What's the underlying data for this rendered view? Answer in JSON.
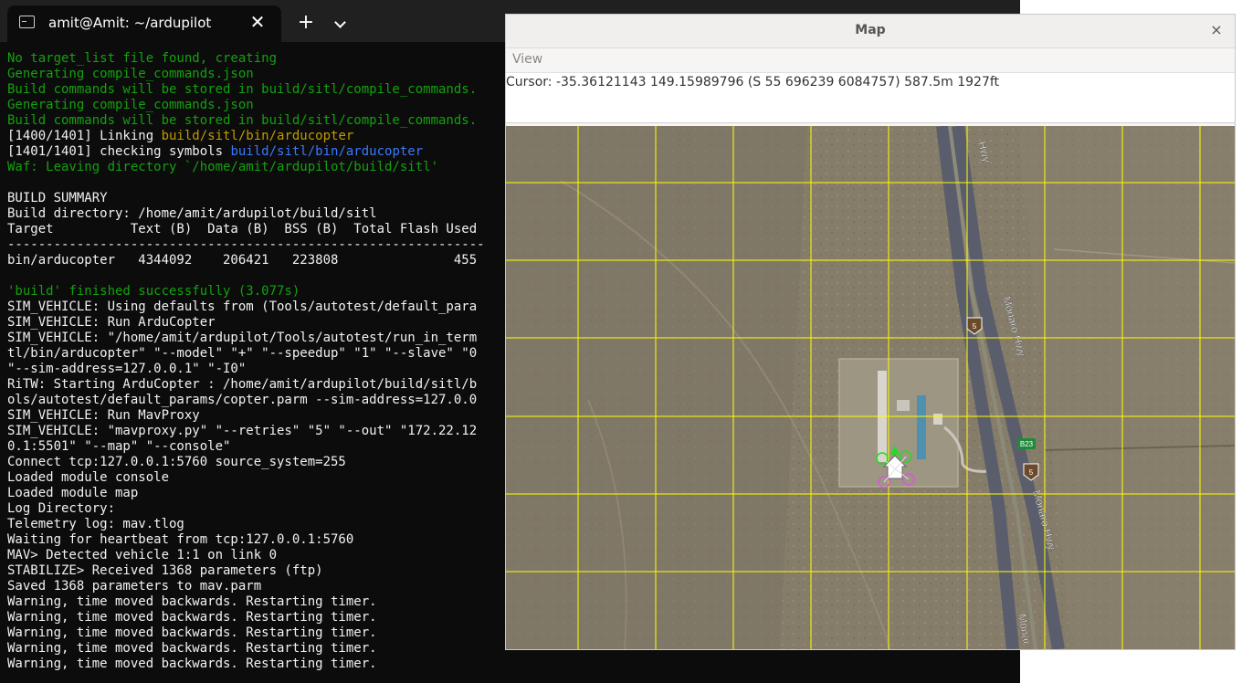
{
  "terminal": {
    "tab_title": "amit@Amit: ~/ardupilot",
    "tab_close": "✕",
    "new_tab": "+",
    "lines": [
      {
        "segs": [
          {
            "t": "No target_list file found, creating",
            "c": "green"
          }
        ]
      },
      {
        "segs": [
          {
            "t": "Generating compile_commands.json",
            "c": "green"
          }
        ]
      },
      {
        "segs": [
          {
            "t": "Build commands will be stored in build/sitl/compile_commands.",
            "c": "green"
          }
        ]
      },
      {
        "segs": [
          {
            "t": "Generating compile_commands.json",
            "c": "green"
          }
        ]
      },
      {
        "segs": [
          {
            "t": "Build commands will be stored in build/sitl/compile_commands.",
            "c": "green"
          }
        ]
      },
      {
        "segs": [
          {
            "t": "[1400/1401] Linking ",
            "c": "white"
          },
          {
            "t": "build/sitl/bin/arducopter",
            "c": "yellow"
          }
        ]
      },
      {
        "segs": [
          {
            "t": "[1401/1401] checking symbols ",
            "c": "white"
          },
          {
            "t": "build/sitl/bin/arducopter",
            "c": "blue"
          }
        ]
      },
      {
        "segs": [
          {
            "t": "Waf: Leaving directory `/home/amit/ardupilot/build/sitl'",
            "c": "green"
          }
        ]
      },
      {
        "segs": [
          {
            "t": "",
            "c": "white"
          }
        ]
      },
      {
        "segs": [
          {
            "t": "BUILD SUMMARY",
            "c": "white"
          }
        ]
      },
      {
        "segs": [
          {
            "t": "Build directory: /home/amit/ardupilot/build/sitl",
            "c": "white"
          }
        ]
      },
      {
        "segs": [
          {
            "t": "Target          Text (B)  Data (B)  BSS (B)  Total Flash Used",
            "c": "white"
          }
        ]
      },
      {
        "segs": [
          {
            "t": "--------------------------------------------------------------",
            "c": "white"
          }
        ]
      },
      {
        "segs": [
          {
            "t": "bin/arducopter   4344092    206421   223808               455",
            "c": "white"
          }
        ]
      },
      {
        "segs": [
          {
            "t": "",
            "c": "white"
          }
        ]
      },
      {
        "segs": [
          {
            "t": "'build' finished successfully (3.077s)",
            "c": "green"
          }
        ]
      },
      {
        "segs": [
          {
            "t": "SIM_VEHICLE: Using defaults from (Tools/autotest/default_para",
            "c": "white"
          }
        ]
      },
      {
        "segs": [
          {
            "t": "SIM_VEHICLE: Run ArduCopter",
            "c": "white"
          }
        ]
      },
      {
        "segs": [
          {
            "t": "SIM_VEHICLE: \"/home/amit/ardupilot/Tools/autotest/run_in_term",
            "c": "white"
          }
        ]
      },
      {
        "segs": [
          {
            "t": "tl/bin/arducopter\" \"--model\" \"+\" \"--speedup\" \"1\" \"--slave\" \"0",
            "c": "white"
          }
        ]
      },
      {
        "segs": [
          {
            "t": "\"--sim-address=127.0.0.1\" \"-I0\"",
            "c": "white"
          }
        ]
      },
      {
        "segs": [
          {
            "t": "RiTW: Starting ArduCopter : /home/amit/ardupilot/build/sitl/b",
            "c": "white"
          }
        ]
      },
      {
        "segs": [
          {
            "t": "ols/autotest/default_params/copter.parm --sim-address=127.0.0",
            "c": "white"
          }
        ]
      },
      {
        "segs": [
          {
            "t": "SIM_VEHICLE: Run MavProxy",
            "c": "white"
          }
        ]
      },
      {
        "segs": [
          {
            "t": "SIM_VEHICLE: \"mavproxy.py\" \"--retries\" \"5\" \"--out\" \"172.22.12",
            "c": "white"
          }
        ]
      },
      {
        "segs": [
          {
            "t": "0.1:5501\" \"--map\" \"--console\"",
            "c": "white"
          }
        ]
      },
      {
        "segs": [
          {
            "t": "Connect tcp:127.0.0.1:5760 source_system=255",
            "c": "white"
          }
        ]
      },
      {
        "segs": [
          {
            "t": "Loaded module console",
            "c": "white"
          }
        ]
      },
      {
        "segs": [
          {
            "t": "Loaded module map",
            "c": "white"
          }
        ]
      },
      {
        "segs": [
          {
            "t": "Log Directory:",
            "c": "white"
          }
        ]
      },
      {
        "segs": [
          {
            "t": "Telemetry log: mav.tlog",
            "c": "white"
          }
        ]
      },
      {
        "segs": [
          {
            "t": "Waiting for heartbeat from tcp:127.0.0.1:5760",
            "c": "white"
          }
        ]
      },
      {
        "segs": [
          {
            "t": "MAV> Detected vehicle 1:1 on link 0",
            "c": "white"
          }
        ]
      },
      {
        "segs": [
          {
            "t": "STABILIZE> Received 1368 parameters (ftp)",
            "c": "white"
          }
        ]
      },
      {
        "segs": [
          {
            "t": "Saved 1368 parameters to mav.parm",
            "c": "white"
          }
        ]
      },
      {
        "segs": [
          {
            "t": "Warning, time moved backwards. Restarting timer.",
            "c": "white"
          }
        ]
      },
      {
        "segs": [
          {
            "t": "Warning, time moved backwards. Restarting timer.",
            "c": "white"
          }
        ]
      },
      {
        "segs": [
          {
            "t": "Warning, time moved backwards. Restarting timer.",
            "c": "white"
          }
        ]
      },
      {
        "segs": [
          {
            "t": "Warning, time moved backwards. Restarting timer.",
            "c": "white"
          }
        ]
      },
      {
        "segs": [
          {
            "t": "Warning, time moved backwards. Restarting timer.",
            "c": "white"
          }
        ]
      }
    ]
  },
  "map_window": {
    "title": "Map",
    "close": "×",
    "menu_view": "View",
    "cursor_readout": "Cursor: -35.36121143 149.15989796 (S 55 696239 6084757) 587.5m 1927ft",
    "labels": {
      "hwy_top": "Hwy",
      "monaro_1": "Monaro Hwy",
      "monaro_2": "Monaro Hwy",
      "monaro_3": "Monar",
      "shield_a": "5",
      "shield_b": "5",
      "route_b23": "B23"
    },
    "colors": {
      "grid": "#ffff00",
      "waypoint_green": "#22dd22",
      "waypoint_pink": "#dd55dd",
      "terrain": "#857d6a",
      "road": "#5a5d6c"
    }
  }
}
